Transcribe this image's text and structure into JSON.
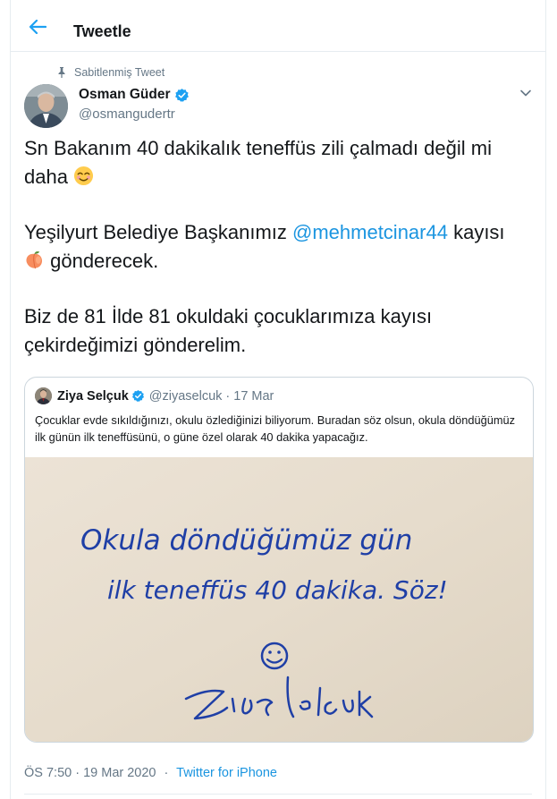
{
  "header": {
    "title": "Tweetle",
    "back_icon": "arrow-left-icon"
  },
  "tweet": {
    "pinned_label": "Sabitlenmiş Tweet",
    "author_name": "Osman Güder",
    "author_handle": "@osmangudertr",
    "para1_text": "Sn Bakanım 40 dakikalık teneffüs zili çalmadı değil mi daha",
    "para1_emoji": "smiling-face-emoji",
    "para2_prefix": "Yeşilyurt Belediye Başkanımız ",
    "para2_mention": "@mehmetcinar44",
    "para2_mid": " kayısı",
    "para2_emoji": "peach-emoji",
    "para2_suffix": " gönderecek.",
    "para3_text": "Biz de 81 İlde 81 okuldaki çocuklarımıza kayısı çekirdeğimizi gönderelim.",
    "timestamp": "ÖS 7:50 · 19 Mar 2020",
    "separator": "·",
    "source": "Twitter for iPhone"
  },
  "quote": {
    "author_name": "Ziya Selçuk",
    "author_handle": "@ziyaselcuk",
    "dot": "·",
    "date": "17 Mar",
    "text": "Çocuklar evde sıkıldığınızı, okulu özlediğinizi biliyorum. Buradan söz olsun, okula döndüğümüz ilk günün ilk teneffüsünü, o güne özel olarak 40 dakika yapacağız.",
    "image": {
      "line1": "Okula döndüğümüz gün",
      "line2": "ilk teneffüs 40 dakika. Söz!",
      "signature": "Ziya Selçuk"
    }
  },
  "colors": {
    "link": "#1b95e0",
    "muted": "#657786",
    "border": "#e6ecf0",
    "ink": "#1f3fa6"
  }
}
